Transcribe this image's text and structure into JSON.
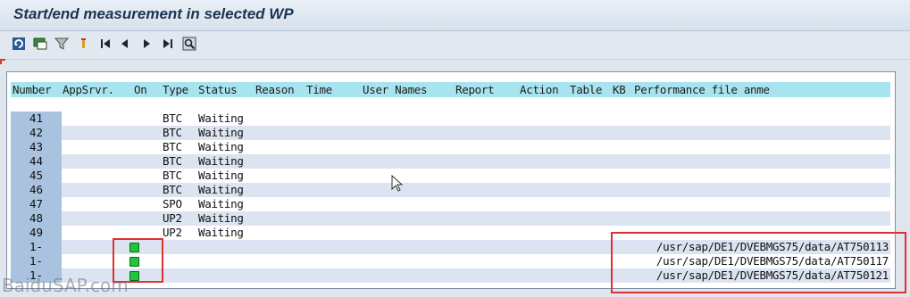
{
  "window": {
    "title": "Start/end measurement in selected WP"
  },
  "toolbar": {
    "buttons": [
      {
        "name": "refresh-icon"
      },
      {
        "name": "display-icon"
      },
      {
        "name": "filter-icon"
      },
      {
        "name": "marker-icon"
      },
      {
        "name": "first-page-icon"
      },
      {
        "name": "previous-page-icon"
      },
      {
        "name": "next-page-icon"
      },
      {
        "name": "last-page-icon"
      },
      {
        "name": "find-icon"
      }
    ]
  },
  "table": {
    "headers": {
      "number": "Number",
      "appsrvr": "AppSrvr.",
      "on": "On",
      "type": "Type",
      "status": "Status",
      "reason": "Reason",
      "time": "Time",
      "user_names": "User Names",
      "report": "Report",
      "action": "Action",
      "table": "Table",
      "kb": "KB",
      "perf_file": "Performance file anme"
    },
    "rows": [
      {
        "number": "41",
        "type": "BTC",
        "status": "Waiting",
        "on": false,
        "file": ""
      },
      {
        "number": "42",
        "type": "BTC",
        "status": "Waiting",
        "on": false,
        "file": ""
      },
      {
        "number": "43",
        "type": "BTC",
        "status": "Waiting",
        "on": false,
        "file": ""
      },
      {
        "number": "44",
        "type": "BTC",
        "status": "Waiting",
        "on": false,
        "file": ""
      },
      {
        "number": "45",
        "type": "BTC",
        "status": "Waiting",
        "on": false,
        "file": ""
      },
      {
        "number": "46",
        "type": "BTC",
        "status": "Waiting",
        "on": false,
        "file": ""
      },
      {
        "number": "47",
        "type": "SPO",
        "status": "Waiting",
        "on": false,
        "file": ""
      },
      {
        "number": "48",
        "type": "UP2",
        "status": "Waiting",
        "on": false,
        "file": ""
      },
      {
        "number": "49",
        "type": "UP2",
        "status": "Waiting",
        "on": false,
        "file": ""
      },
      {
        "number": "1-",
        "type": "",
        "status": "",
        "on": true,
        "file": "/usr/sap/DE1/DVEBMGS75/data/AT750113"
      },
      {
        "number": "1-",
        "type": "",
        "status": "",
        "on": true,
        "file": "/usr/sap/DE1/DVEBMGS75/data/AT750117"
      },
      {
        "number": "1-",
        "type": "",
        "status": "",
        "on": true,
        "file": "/usr/sap/DE1/DVEBMGS75/data/AT750121"
      }
    ]
  },
  "watermark": "BaiduSAP.com",
  "colors": {
    "on_indicator": "#22c43a",
    "highlight_box": "#e03030",
    "header_bg": "#a8e4ef"
  }
}
